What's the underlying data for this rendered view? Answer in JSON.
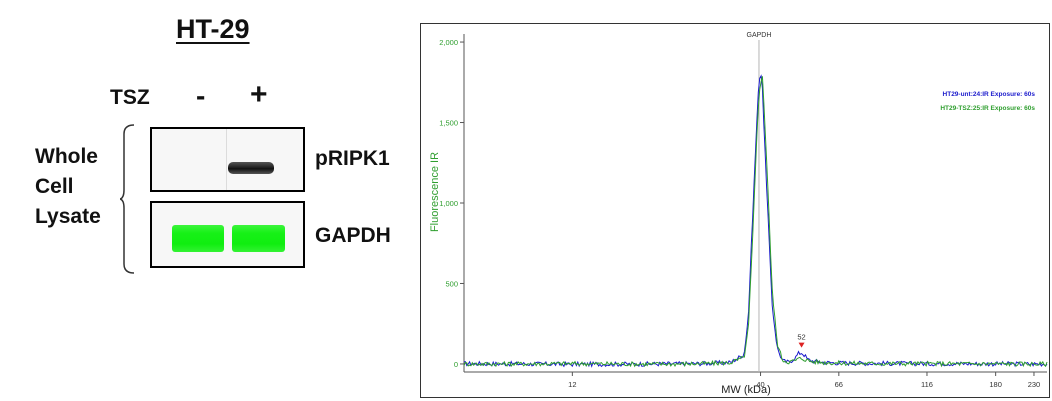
{
  "blot": {
    "cell_line": "HT-29",
    "treatment_label": "TSZ",
    "lanes": [
      "-",
      "+"
    ],
    "sample_label": [
      "Whole",
      "Cell",
      "Lysate"
    ],
    "targets": [
      "pRIPK1",
      "GAPDH"
    ]
  },
  "chart_data": {
    "type": "line",
    "title": "",
    "xlabel": "MW (kDa)",
    "ylabel": "Fluorescence IR",
    "x_ticks": [
      "12",
      "40",
      "66",
      "116",
      "180",
      "230"
    ],
    "y_ticks": [
      "0",
      "500",
      "1,000",
      "1,500",
      "2,000"
    ],
    "ylim": [
      -50,
      2050
    ],
    "peak_marker_label": "GAPDH",
    "annotation": {
      "label": "52",
      "x": 52,
      "y": 70
    },
    "grid": false,
    "legend_position": "top-right",
    "series": [
      {
        "name": "HT29-unt:24:IR Exposure: 60s",
        "color": "#1a1acc",
        "points": [
          [
            6,
            2
          ],
          [
            12,
            -2
          ],
          [
            20,
            0
          ],
          [
            28,
            3
          ],
          [
            33,
            10
          ],
          [
            36,
            60
          ],
          [
            37,
            300
          ],
          [
            38,
            900
          ],
          [
            39,
            1480
          ],
          [
            39.6,
            1760
          ],
          [
            40,
            1820
          ],
          [
            40.5,
            1720
          ],
          [
            41,
            1400
          ],
          [
            42,
            900
          ],
          [
            43,
            380
          ],
          [
            44.5,
            100
          ],
          [
            46,
            20
          ],
          [
            48,
            10
          ],
          [
            50,
            40
          ],
          [
            51,
            65
          ],
          [
            52,
            70
          ],
          [
            53,
            55
          ],
          [
            54,
            28
          ],
          [
            56,
            18
          ],
          [
            60,
            10
          ],
          [
            66,
            6
          ],
          [
            80,
            4
          ],
          [
            116,
            2
          ],
          [
            150,
            2
          ],
          [
            180,
            1
          ],
          [
            230,
            0
          ],
          [
            250,
            0
          ]
        ]
      },
      {
        "name": "HT29-TSZ:25:IR Exposure: 60s",
        "color": "#2e9e2e",
        "points": [
          [
            6,
            0
          ],
          [
            12,
            2
          ],
          [
            20,
            -1
          ],
          [
            28,
            2
          ],
          [
            33,
            8
          ],
          [
            36,
            40
          ],
          [
            37,
            220
          ],
          [
            38,
            760
          ],
          [
            39,
            1380
          ],
          [
            39.6,
            1680
          ],
          [
            40,
            1760
          ],
          [
            40.5,
            1780
          ],
          [
            41,
            1560
          ],
          [
            42,
            1060
          ],
          [
            43,
            480
          ],
          [
            44.5,
            130
          ],
          [
            46,
            25
          ],
          [
            48,
            12
          ],
          [
            50,
            22
          ],
          [
            51,
            32
          ],
          [
            52,
            35
          ],
          [
            53,
            30
          ],
          [
            54,
            22
          ],
          [
            56,
            14
          ],
          [
            60,
            9
          ],
          [
            66,
            5
          ],
          [
            80,
            3
          ],
          [
            116,
            2
          ],
          [
            150,
            1
          ],
          [
            180,
            1
          ],
          [
            230,
            0
          ],
          [
            250,
            0
          ]
        ]
      }
    ]
  }
}
